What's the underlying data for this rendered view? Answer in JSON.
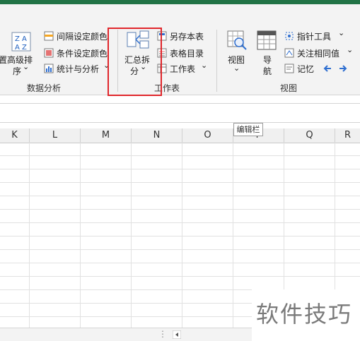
{
  "ribbon": {
    "sort_label_1": "高级排",
    "sort_label_2": "序",
    "sort_chev": "⌄",
    "sort_partial": "置",
    "data_items": [
      "间隔设定颜色",
      "条件设定颜色",
      "统计与分析"
    ],
    "data_group": "数据分析",
    "summary_split_1": "汇总拆",
    "summary_split_2": "分",
    "worksheet_items": [
      "另存本表",
      "表格目录",
      "工作表"
    ],
    "worksheet_group": "工作表",
    "view_label": "视图",
    "nav_label_1": "导",
    "nav_label_2": "航",
    "view_items": [
      "指针工具",
      "关注相同值",
      "记忆"
    ],
    "view_group": "视图"
  },
  "columns": [
    "K",
    "L",
    "M",
    "N",
    "O",
    "P",
    "Q",
    "R"
  ],
  "tooltip": "编辑栏",
  "watermark": "软件技巧",
  "colors": {
    "accent": "#217346",
    "highlight": "#e0262b",
    "arrow": "#2f6fd0"
  }
}
